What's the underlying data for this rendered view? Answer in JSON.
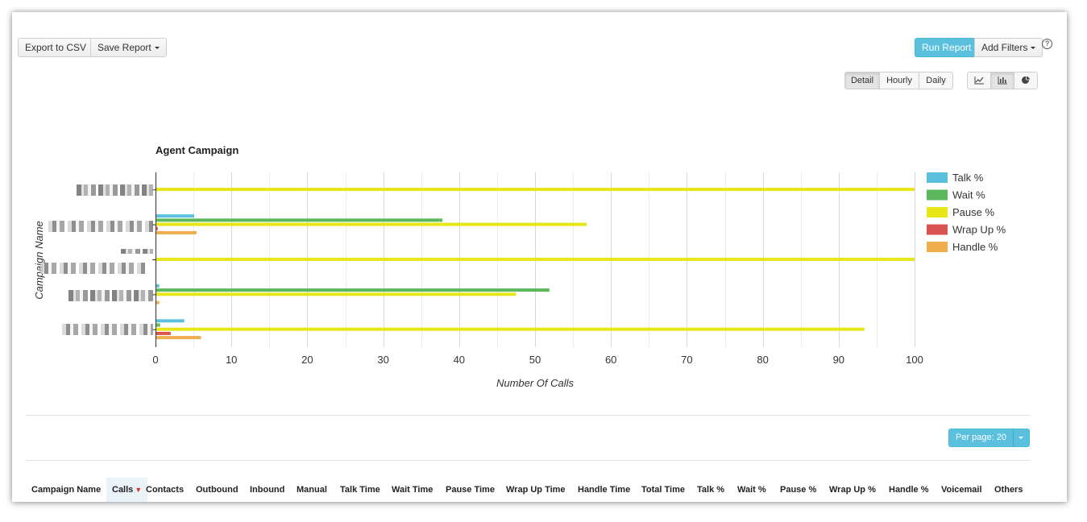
{
  "toolbar": {
    "export_label": "Export to CSV",
    "save_label": "Save Report",
    "run_label": "Run Report",
    "filters_label": "Add Filters",
    "help_label": "?"
  },
  "view": {
    "granularity": [
      "Detail",
      "Hourly",
      "Daily"
    ],
    "selected": "Detail",
    "chart_types": [
      "line-chart-icon",
      "bar-chart-icon",
      "pie-chart-icon"
    ],
    "selected_chart_type": "bar-chart-icon"
  },
  "colors": {
    "primary": "#5bc0de",
    "talk": "#5bc0de",
    "wait": "#5cb85c",
    "pause": "#e6e619",
    "wrapup": "#d9534f",
    "handle": "#f0ad4e"
  },
  "chart_data": {
    "type": "bar",
    "orientation": "horizontal",
    "title": "Agent Campaign",
    "xlabel": "Number Of Calls",
    "ylabel": "Campaign Name",
    "xlim": [
      0,
      100
    ],
    "x_ticks": [
      "0",
      "10",
      "20",
      "30",
      "40",
      "50",
      "60",
      "70",
      "80",
      "90",
      "100"
    ],
    "grid": true,
    "legend_position": "right",
    "categories": [
      "",
      "",
      "",
      "",
      ""
    ],
    "series": [
      {
        "name": "Talk %",
        "color": "#5bc0de",
        "values": [
          0,
          5.1,
          0,
          0.5,
          3.8
        ]
      },
      {
        "name": "Wait %",
        "color": "#5cb85c",
        "values": [
          0,
          37.8,
          0,
          51.9,
          0.6
        ]
      },
      {
        "name": "Pause %",
        "color": "#e6e619",
        "values": [
          100,
          56.8,
          100,
          47.5,
          93.4
        ]
      },
      {
        "name": "Wrap Up %",
        "color": "#d9534f",
        "values": [
          0,
          0.3,
          0,
          0,
          2.0
        ]
      },
      {
        "name": "Handle %",
        "color": "#f0ad4e",
        "values": [
          0,
          5.4,
          0,
          0.5,
          6.0
        ]
      }
    ]
  },
  "pagination": {
    "per_page_label": "Per page: 20"
  },
  "table": {
    "sorted_column": "Calls",
    "columns": [
      "Campaign Name",
      "Calls",
      "Contacts",
      "Outbound",
      "Inbound",
      "Manual",
      "Talk Time",
      "Wait Time",
      "Pause Time",
      "Wrap Up Time",
      "Handle Time",
      "Total Time",
      "Talk %",
      "Wait %",
      "Pause %",
      "Wrap Up %",
      "Handle %",
      "Voicemail",
      "Others"
    ]
  }
}
